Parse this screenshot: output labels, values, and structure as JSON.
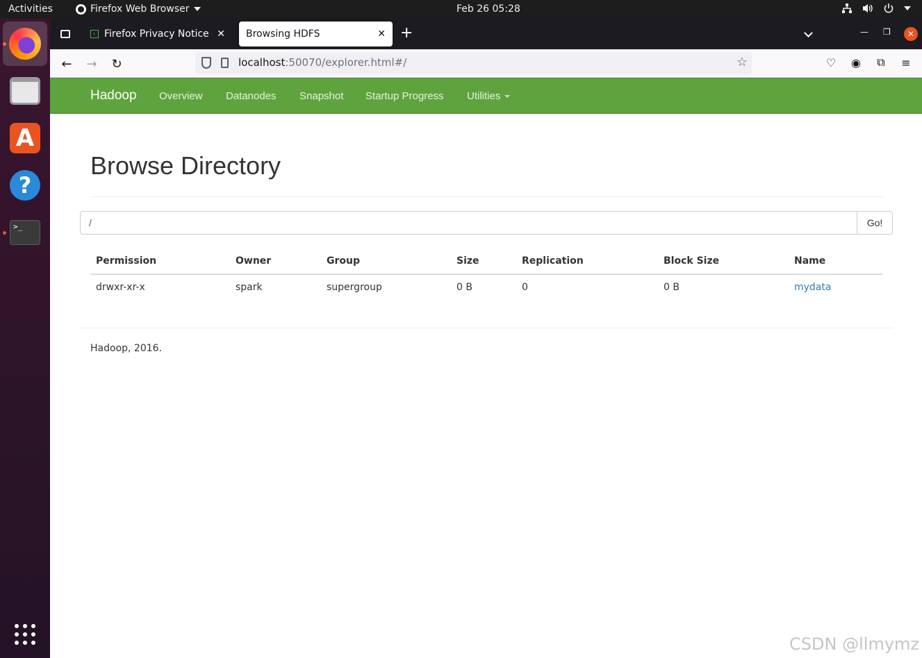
{
  "topbar": {
    "activities": "Activities",
    "app_name": "Firefox Web Browser",
    "clock": "Feb 26  05:28"
  },
  "browser": {
    "tabs": [
      {
        "title": "Firefox Privacy Notice —",
        "active": false
      },
      {
        "title": "Browsing HDFS",
        "active": true
      }
    ],
    "url_host": "localhost",
    "url_rest": ":50070/explorer.html#/"
  },
  "hadoop_nav": {
    "brand": "Hadoop",
    "items": [
      "Overview",
      "Datanodes",
      "Snapshot",
      "Startup Progress",
      "Utilities"
    ]
  },
  "page": {
    "title": "Browse Directory",
    "path_value": "/",
    "go_label": "Go!"
  },
  "table": {
    "headers": [
      "Permission",
      "Owner",
      "Group",
      "Size",
      "Replication",
      "Block Size",
      "Name"
    ],
    "rows": [
      [
        "drwxr-xr-x",
        "spark",
        "supergroup",
        "0 B",
        "0",
        "0 B",
        "mydata"
      ]
    ]
  },
  "footer": "Hadoop, 2016.",
  "watermark": "CSDN @llmymz",
  "colors": {
    "navbar_green": "#5fa33e",
    "link_blue": "#337ab7",
    "ubuntu_orange": "#e95420"
  }
}
